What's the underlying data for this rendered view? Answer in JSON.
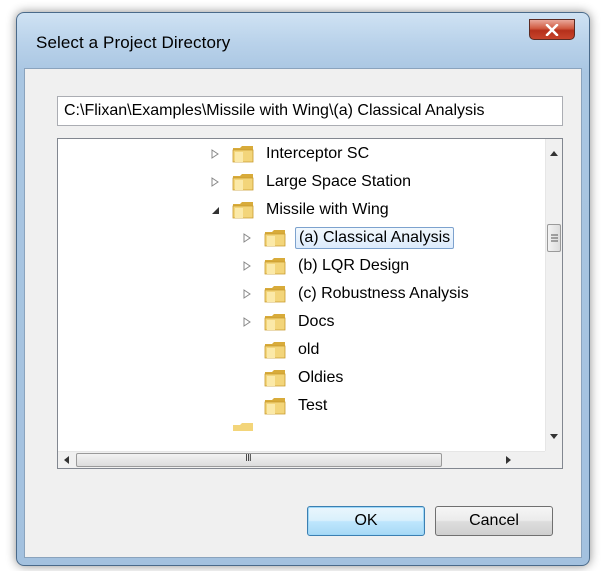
{
  "dialog": {
    "title": "Select a Project Directory",
    "close_symbol": "x"
  },
  "path": {
    "value": "C:\\Flixan\\Examples\\Missile with Wing\\(a) Classical Analysis"
  },
  "tree": {
    "items": [
      {
        "label": "Interceptor SC",
        "expander": "collapsed"
      },
      {
        "label": "Large Space Station",
        "expander": "collapsed"
      },
      {
        "label": "Missile with Wing",
        "expander": "expanded"
      },
      {
        "label": "(a) Classical Analysis",
        "expander": "collapsed",
        "selected": true
      },
      {
        "label": "(b) LQR Design",
        "expander": "collapsed"
      },
      {
        "label": "(c) Robustness Analysis",
        "expander": "collapsed"
      },
      {
        "label": "Docs",
        "expander": "collapsed"
      },
      {
        "label": "old",
        "expander": "none"
      },
      {
        "label": "Oldies",
        "expander": "none"
      },
      {
        "label": "Test",
        "expander": "none"
      }
    ],
    "hscroll_thumb_glyph": "III"
  },
  "buttons": {
    "ok_label": "OK",
    "cancel_label": "Cancel"
  },
  "icons": {
    "folder": "folder-icon",
    "expander_collapsed": "triangle-right-icon",
    "expander_expanded": "triangle-down-icon"
  },
  "colors": {
    "frame": "#a9c6e2",
    "client": "#f0f0f0",
    "close_button": "#c7442c",
    "selection_border": "#7da2ce",
    "default_button_border": "#3c7fb1"
  }
}
